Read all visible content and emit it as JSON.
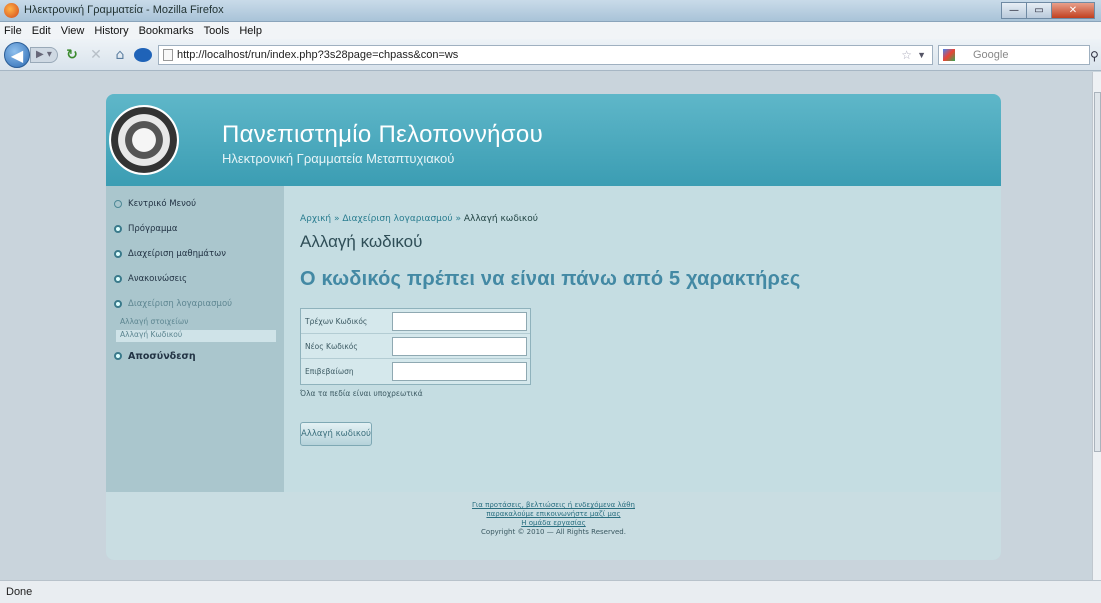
{
  "window": {
    "title": "Ηλεκτρονική Γραμματεία - Mozilla Firefox",
    "min": "—",
    "max": "▭",
    "close": "✕"
  },
  "menu": [
    "File",
    "Edit",
    "View",
    "History",
    "Bookmarks",
    "Tools",
    "Help"
  ],
  "nav": {
    "url": "http://localhost/run/index.php?3s28page=chpass&con=ws",
    "search_placeholder": "Google"
  },
  "site": {
    "title": "Πανεπιστημίο Πελοποννήσου",
    "subtitle": "Ηλεκτρονική Γραμματεία Μεταπτυχιακού"
  },
  "sidebar": {
    "items": [
      {
        "label": "Κεντρικό Μενού"
      },
      {
        "label": "Πρόγραμμα"
      },
      {
        "label": "Διαχείριση μαθημάτων"
      },
      {
        "label": "Ανακοινώσεις"
      },
      {
        "label": "Διαχείριση λογαριασμού"
      },
      {
        "label": "Αποσύνδεση"
      }
    ],
    "subitems": [
      {
        "label": "Αλλαγή στοιχείων"
      },
      {
        "label": "Αλλαγή Κωδικού"
      }
    ]
  },
  "breadcrumb": {
    "home": "Αρχική",
    "section": "Διαχείριση λογαριασμού",
    "current": "Αλλαγή κωδικού",
    "sep": "»"
  },
  "page_title": "Αλλαγή κωδικού",
  "error_message": "Ο κωδικός πρέπει να είναι πάνω από 5 χαρακτήρες",
  "form": {
    "fields": [
      {
        "label": "Τρέχων Κωδικός",
        "value": ""
      },
      {
        "label": "Νέος Κωδικός",
        "value": ""
      },
      {
        "label": "Επιβεβαίωση",
        "value": ""
      }
    ],
    "required_note": "Όλα τα πεδία είναι υποχρεωτικά",
    "submit_label": "Αλλαγή κωδικού"
  },
  "footer": {
    "line1": "Για προτάσεις, βελτιώσεις ή ενδεχόμενα λάθη",
    "line2": "παρακαλούμε επικοινωνήστε μαζί μας",
    "line3": "Η ομάδα εργασίας",
    "copyright": "Copyright © 2010 — All Rights Reserved."
  },
  "status": "Done"
}
